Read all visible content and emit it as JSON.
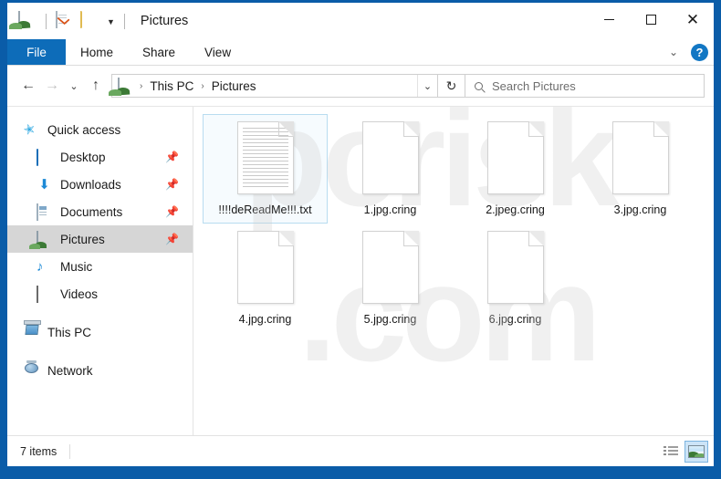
{
  "window": {
    "title": "Pictures",
    "quick_access_toolbar": [
      {
        "name": "picture-icon",
        "label": "Pictures"
      },
      {
        "name": "properties-icon",
        "label": "Properties"
      },
      {
        "name": "new-folder-icon",
        "label": "New folder"
      },
      {
        "name": "chevron-down-icon",
        "label": "Customize Quick Access Toolbar"
      }
    ],
    "controls": {
      "minimize": "—",
      "maximize": "□",
      "close": "✕"
    }
  },
  "ribbon": {
    "tabs": [
      {
        "id": "file",
        "label": "File",
        "selected": true
      },
      {
        "id": "home",
        "label": "Home",
        "selected": false
      },
      {
        "id": "share",
        "label": "Share",
        "selected": false
      },
      {
        "id": "view",
        "label": "View",
        "selected": false
      }
    ],
    "collapse_chevron": "⌄",
    "help_label": "?"
  },
  "address": {
    "back": "←",
    "forward": "→",
    "recent": "⌄",
    "up": "↑",
    "breadcrumbs": [
      {
        "label": "This PC"
      },
      {
        "label": "Pictures"
      }
    ],
    "separator": "›",
    "dropdown": "⌄",
    "refresh": "↻"
  },
  "search": {
    "placeholder": "Search Pictures",
    "value": ""
  },
  "sidebar": {
    "items": [
      {
        "label": "Quick access",
        "icon": "star-icon",
        "indent": false,
        "pinned": false,
        "selected": false
      },
      {
        "label": "Desktop",
        "icon": "desktop-icon",
        "indent": true,
        "pinned": true,
        "selected": false
      },
      {
        "label": "Downloads",
        "icon": "downloads-icon",
        "indent": true,
        "pinned": true,
        "selected": false
      },
      {
        "label": "Documents",
        "icon": "documents-icon",
        "indent": true,
        "pinned": true,
        "selected": false
      },
      {
        "label": "Pictures",
        "icon": "pictures-icon",
        "indent": true,
        "pinned": true,
        "selected": true
      },
      {
        "label": "Music",
        "icon": "music-icon",
        "indent": true,
        "pinned": false,
        "selected": false
      },
      {
        "label": "Videos",
        "icon": "videos-icon",
        "indent": true,
        "pinned": false,
        "selected": false
      },
      {
        "label": "This PC",
        "icon": "this-pc-icon",
        "indent": false,
        "pinned": false,
        "selected": false
      },
      {
        "label": "Network",
        "icon": "network-icon",
        "indent": false,
        "pinned": false,
        "selected": false
      }
    ],
    "pin_glyph": "📌"
  },
  "files": [
    {
      "name": "!!!!deReadMe!!!.txt",
      "icon": "text-file-icon",
      "focused": true
    },
    {
      "name": "1.jpg.cring",
      "icon": "blank-file-icon",
      "focused": false
    },
    {
      "name": "2.jpeg.cring",
      "icon": "blank-file-icon",
      "focused": false
    },
    {
      "name": "3.jpg.cring",
      "icon": "blank-file-icon",
      "focused": false
    },
    {
      "name": "4.jpg.cring",
      "icon": "blank-file-icon",
      "focused": false
    },
    {
      "name": "5.jpg.cring",
      "icon": "blank-file-icon",
      "focused": false
    },
    {
      "name": "6.jpg.cring",
      "icon": "blank-file-icon",
      "focused": false
    }
  ],
  "watermark": {
    "line1": "pcrisk",
    "line2": ".com"
  },
  "statusbar": {
    "item_count": "7 items",
    "views": [
      {
        "id": "details",
        "label": "Details view",
        "active": false
      },
      {
        "id": "large-icons",
        "label": "Large icons view",
        "active": true
      }
    ]
  },
  "colors": {
    "window_border": "#0a5ca8",
    "tab_active": "#0d6cb9",
    "selection": "#d6d6d6",
    "focus_border": "#b8dcf0",
    "help_blue": "#1277c4"
  }
}
